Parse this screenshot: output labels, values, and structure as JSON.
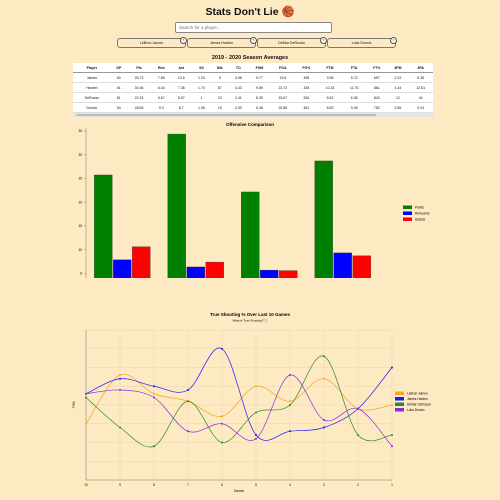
{
  "app": {
    "title": "Stats Don't Lie",
    "title_icon": "🏀"
  },
  "search": {
    "placeholder": "Search for a player..."
  },
  "players": [
    {
      "label": "LeBron James",
      "remove_icon": "close-circle-icon"
    },
    {
      "label": "James Harden",
      "remove_icon": "close-circle-icon"
    },
    {
      "label": "DeMar DeRozan",
      "remove_icon": "close-circle-icon"
    },
    {
      "label": "Luka Doncic",
      "remove_icon": "close-circle-icon"
    }
  ],
  "season_table": {
    "title": "2019 - 2020 Season Averages",
    "columns": [
      "Player",
      "GP",
      "Pts",
      "Reb",
      "Ast",
      "Stl",
      "Blk",
      "TO",
      "FGM",
      "FGA",
      "FG%",
      "FTM",
      "FTA",
      "FT%",
      "3PM",
      "3PA"
    ],
    "rows": [
      [
        "James",
        "60",
        "25.73",
        "7.85",
        "10.6",
        "1.23",
        "5",
        "3.98",
        "9.77",
        "19.6",
        "498",
        "3.98",
        "5.72",
        "697",
        "2.22",
        "6.35"
      ],
      [
        "Harden",
        "61",
        "34.36",
        "6.34",
        "7.36",
        "1.74",
        "87",
        "4.43",
        "9.89",
        "22.72",
        "435",
        "10.15",
        "11.76",
        "861",
        "4.44",
        "12.61"
      ],
      [
        "DeRozan",
        "61",
        "22.15",
        "5.67",
        "5.57",
        "1",
        "23",
        "2.41",
        "8.25",
        "15.67",
        "526",
        "5.52",
        "6.36",
        "843",
        "12",
        "44"
      ],
      [
        "Doncic",
        "54",
        "28.69",
        "9.3",
        "8.7",
        "1.06",
        "15",
        "4.33",
        "9.48",
        "20.56",
        "461",
        "6.83",
        "9.09",
        "752",
        "2.86",
        "9.04"
      ]
    ]
  },
  "colors": {
    "background": "#fde9c2",
    "points": "#008000",
    "rebounds": "#0000ff",
    "assists": "#ff0000",
    "lebron": "#f5a623",
    "harden": "#1a1aff",
    "derozan": "#2e8b2e",
    "doncic": "#8a2be2"
  },
  "chart_data": [
    {
      "type": "bar",
      "title": "Offensive Comparison",
      "categories": [
        "LeBron James",
        "James Harden",
        "DeMar DeRozan",
        "Luka Doncic"
      ],
      "series": [
        {
          "name": "Points",
          "values": [
            25.73,
            34.36,
            22.15,
            28.69
          ]
        },
        {
          "name": "Rebounds",
          "values": [
            7.85,
            6.34,
            5.67,
            9.3
          ]
        },
        {
          "name": "Assists",
          "values": [
            10.6,
            7.36,
            5.57,
            8.7
          ]
        }
      ],
      "ylim": [
        0,
        35
      ],
      "yticks": [
        0,
        5,
        10,
        15,
        20,
        25,
        30,
        35
      ],
      "legend": "right"
    },
    {
      "type": "line",
      "title": "True Shooting % Over Last 10 Games",
      "subtitle": "What is True Shooting? ⓘ",
      "xlabel": "Games",
      "ylabel": "TS%",
      "categories": [
        "10",
        "9",
        "8",
        "7",
        "6",
        "5",
        "4",
        "3",
        "2",
        "1"
      ],
      "series": [
        {
          "name": "LeBron James",
          "values": [
            0.5,
            0.63,
            0.58,
            0.56,
            0.52,
            0.6,
            0.56,
            0.62,
            0.54,
            0.55
          ]
        },
        {
          "name": "James Harden",
          "values": [
            0.58,
            0.62,
            0.6,
            0.59,
            0.7,
            0.47,
            0.48,
            0.49,
            0.54,
            0.65
          ]
        },
        {
          "name": "DeMar DeRozan",
          "values": [
            0.57,
            0.49,
            0.44,
            0.56,
            0.45,
            0.53,
            0.55,
            0.68,
            0.47,
            0.47
          ]
        },
        {
          "name": "Luka Doncic",
          "values": [
            0.58,
            0.59,
            0.57,
            0.48,
            0.5,
            0.46,
            0.63,
            0.51,
            0.54,
            0.44
          ]
        }
      ],
      "ylim": [
        0.35,
        0.75
      ],
      "legend": "right"
    }
  ]
}
